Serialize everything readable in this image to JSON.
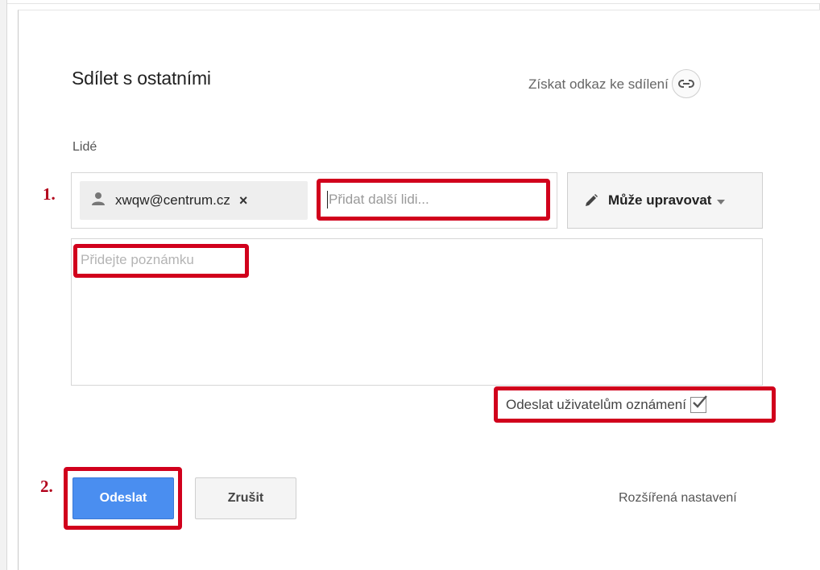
{
  "dialog": {
    "title": "Sdílet s ostatními",
    "get_link_label": "Získat odkaz ke sdílení",
    "people_label": "Lidé",
    "chip_email": "xwqw@centrum.cz",
    "chip_remove": "×",
    "add_people_placeholder": "Přidat další lidi...",
    "permission_label": "Může upravovat",
    "note_placeholder": "Přidejte poznámku",
    "notify_label": "Odeslat uživatelům oznámení",
    "notify_checked": true,
    "send_label": "Odeslat",
    "cancel_label": "Zrušit",
    "advanced_label": "Rozšířená nastavení"
  },
  "annotations": {
    "step1": "1.",
    "step2": "2.",
    "highlight_color": "#d1001c",
    "step_color": "#b2001a"
  },
  "colors": {
    "primary_button": "#4a8ef0",
    "chip_background": "#eeeeee",
    "button_background": "#f4f4f4"
  },
  "icons": {
    "link": "link-icon",
    "person": "person-icon",
    "pencil": "pencil-icon",
    "dropdown": "chevron-down-icon",
    "checkbox": "checkmark-icon"
  }
}
